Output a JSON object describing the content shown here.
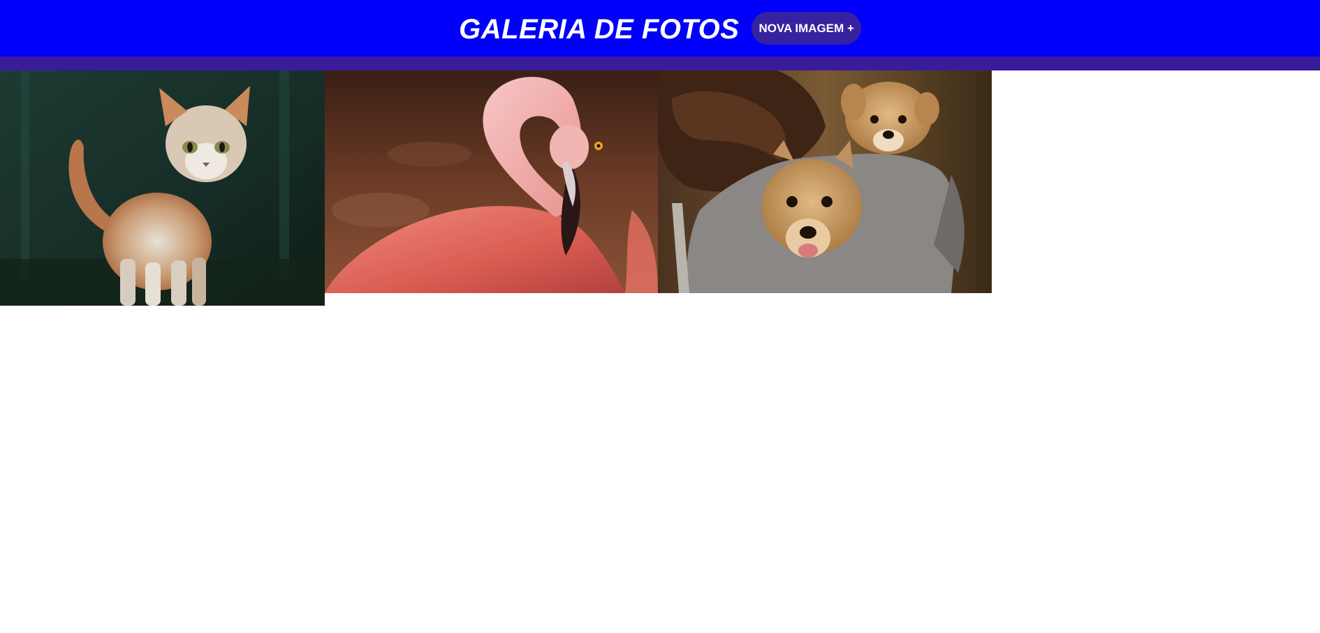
{
  "header": {
    "title": "GALERIA DE FOTOS",
    "new_image_label": "NOVA IMAGEM +"
  },
  "colors": {
    "header_bg": "#0000fb",
    "subbar_bg": "#3a1c9b",
    "button_bg": "#3622a0"
  },
  "gallery": {
    "photos": [
      {
        "subject": "cat"
      },
      {
        "subject": "flamingo"
      },
      {
        "subject": "puppies"
      }
    ]
  }
}
